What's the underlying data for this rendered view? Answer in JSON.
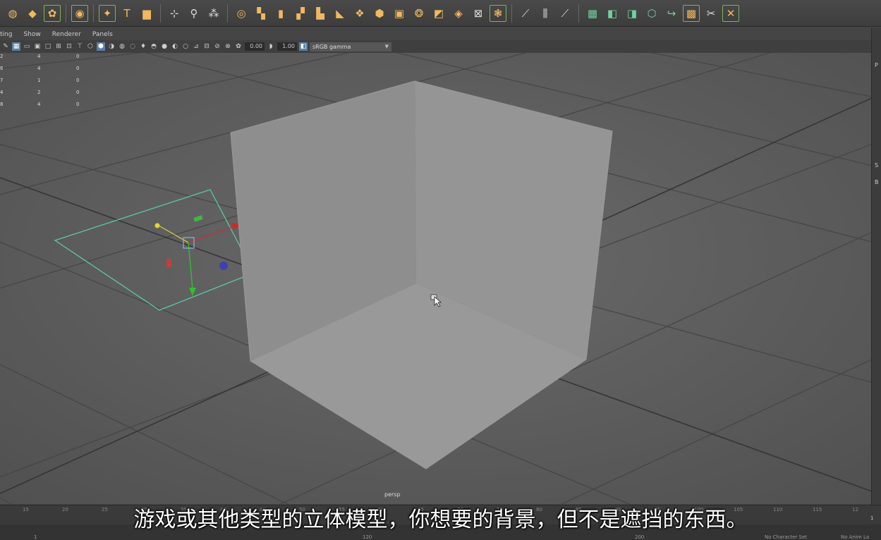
{
  "shelf": {
    "icons": [
      {
        "name": "lasso-icon",
        "glyph": "◍",
        "style": ""
      },
      {
        "name": "select-diamond-icon",
        "glyph": "◆",
        "style": ""
      },
      {
        "name": "paint-select-icon",
        "glyph": "✿",
        "style": "box"
      },
      {
        "name": "sep",
        "glyph": "",
        "style": "sep"
      },
      {
        "name": "sphere-icon",
        "glyph": "◉",
        "style": "box"
      },
      {
        "name": "sep",
        "glyph": "",
        "style": "sep"
      },
      {
        "name": "star-icon",
        "glyph": "✦",
        "style": "box"
      },
      {
        "name": "text-icon",
        "glyph": "T",
        "style": ""
      },
      {
        "name": "svg-icon",
        "glyph": "▆",
        "style": ""
      },
      {
        "name": "sep",
        "glyph": "",
        "style": "sep"
      },
      {
        "name": "pivot-icon",
        "glyph": "⊹",
        "style": "light"
      },
      {
        "name": "center-pivot-icon",
        "glyph": "⚲",
        "style": "light"
      },
      {
        "name": "freeze-icon",
        "glyph": "⁂",
        "style": "light"
      },
      {
        "name": "sep",
        "glyph": "",
        "style": "sep"
      },
      {
        "name": "combine-icon",
        "glyph": "◎",
        "style": ""
      },
      {
        "name": "separate-icon",
        "glyph": "▚",
        "style": ""
      },
      {
        "name": "extract-icon",
        "glyph": "▮",
        "style": ""
      },
      {
        "name": "booleans-icon",
        "glyph": "▞",
        "style": ""
      },
      {
        "name": "smooth-icon",
        "glyph": "▙",
        "style": ""
      },
      {
        "name": "reduce-icon",
        "glyph": "◣",
        "style": ""
      },
      {
        "name": "mirror-icon",
        "glyph": "❖",
        "style": ""
      },
      {
        "name": "cube-icon",
        "glyph": "⬢",
        "style": ""
      },
      {
        "name": "fill-hole-icon",
        "glyph": "▣",
        "style": ""
      },
      {
        "name": "sphere-mesh-icon",
        "glyph": "❂",
        "style": ""
      },
      {
        "name": "extrude-icon",
        "glyph": "◩",
        "style": ""
      },
      {
        "name": "bridge-icon",
        "glyph": "◈",
        "style": ""
      },
      {
        "name": "grid-icon",
        "glyph": "⊠",
        "style": "light"
      },
      {
        "name": "bevel-icon",
        "glyph": "❃",
        "style": "box"
      },
      {
        "name": "sep",
        "glyph": "",
        "style": "sep"
      },
      {
        "name": "multi-cut-icon",
        "glyph": "⟋",
        "style": "light"
      },
      {
        "name": "edge-loop-icon",
        "glyph": "⫼",
        "style": "light"
      },
      {
        "name": "target-weld-icon",
        "glyph": "⟋",
        "style": "light"
      },
      {
        "name": "sep",
        "glyph": "",
        "style": "sep"
      },
      {
        "name": "uv-editor-icon",
        "glyph": "▦",
        "style": "green"
      },
      {
        "name": "planar-map-icon",
        "glyph": "◧",
        "style": "green"
      },
      {
        "name": "cylindrical-map-icon",
        "glyph": "◨",
        "style": "green"
      },
      {
        "name": "spherical-map-icon",
        "glyph": "⬡",
        "style": "green"
      },
      {
        "name": "auto-map-icon",
        "glyph": "↪",
        "style": "green"
      },
      {
        "name": "checker-icon",
        "glyph": "▩",
        "style": "box"
      },
      {
        "name": "cut-uv-icon",
        "glyph": "✂",
        "style": "light"
      },
      {
        "name": "sew-uv-icon",
        "glyph": "✕",
        "style": "box"
      }
    ]
  },
  "panel_menu": [
    "ting",
    "Show",
    "Renderer",
    "Panels"
  ],
  "panel_toolbar": {
    "exposure": "0.00",
    "gamma": "1.00",
    "color_space": "sRGB gamma"
  },
  "hud_rows": [
    [
      "2",
      "4",
      "0"
    ],
    [
      "6",
      "4",
      "0"
    ],
    [
      "7",
      "1",
      "0"
    ],
    [
      "4",
      "2",
      "0"
    ],
    [
      "8",
      "4",
      "0"
    ]
  ],
  "camera_label": "persp",
  "timeline": {
    "ticks": [
      "15",
      "20",
      "25",
      "30",
      "35",
      "40",
      "45",
      "50",
      "55",
      "60",
      "65",
      "70",
      "75",
      "80",
      "85",
      "90",
      "95",
      "100",
      "105",
      "110",
      "115",
      "12"
    ],
    "current_frame": "1",
    "range_start": "1",
    "range_end": "120",
    "range_end_b": "120",
    "anim_end": "200",
    "character_set": "No Character Set",
    "anim_layer": "No Anim La"
  },
  "subtitle": "游戏或其他类型的立体模型，你想要的背景，但不是遮挡的东西。"
}
